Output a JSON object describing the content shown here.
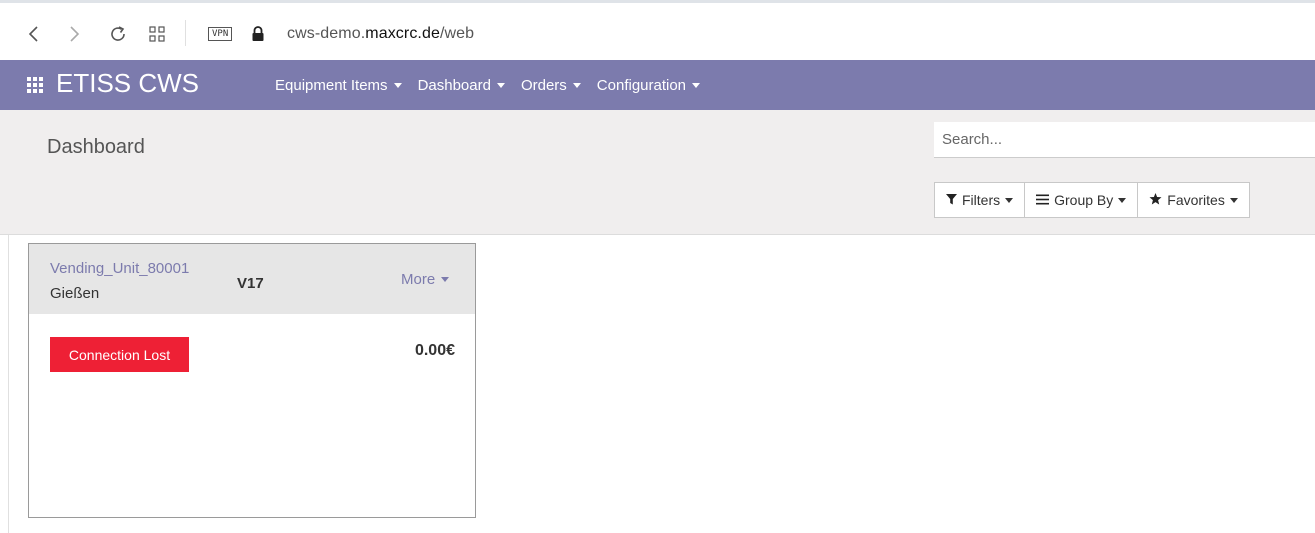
{
  "browser": {
    "vpn_label": "VPN",
    "url_prefix": "cws-demo.",
    "url_host": "maxcrc.de",
    "url_path": "/web"
  },
  "app": {
    "brand": "ETISS CWS",
    "accent_color": "#7c7bad",
    "menu": [
      {
        "label": "Equipment Items"
      },
      {
        "label": "Dashboard"
      },
      {
        "label": "Orders"
      },
      {
        "label": "Configuration"
      }
    ]
  },
  "control_panel": {
    "title": "Dashboard",
    "search": {
      "placeholder": "Search...",
      "value": ""
    },
    "filters_label": "Filters",
    "group_by_label": "Group By",
    "favorites_label": "Favorites"
  },
  "cards": [
    {
      "name": "Vending_Unit_80001",
      "city": "Gießen",
      "version": "V17",
      "more_label": "More",
      "status": "Connection Lost",
      "status_color": "#ee2035",
      "amount": "0.00€"
    }
  ]
}
